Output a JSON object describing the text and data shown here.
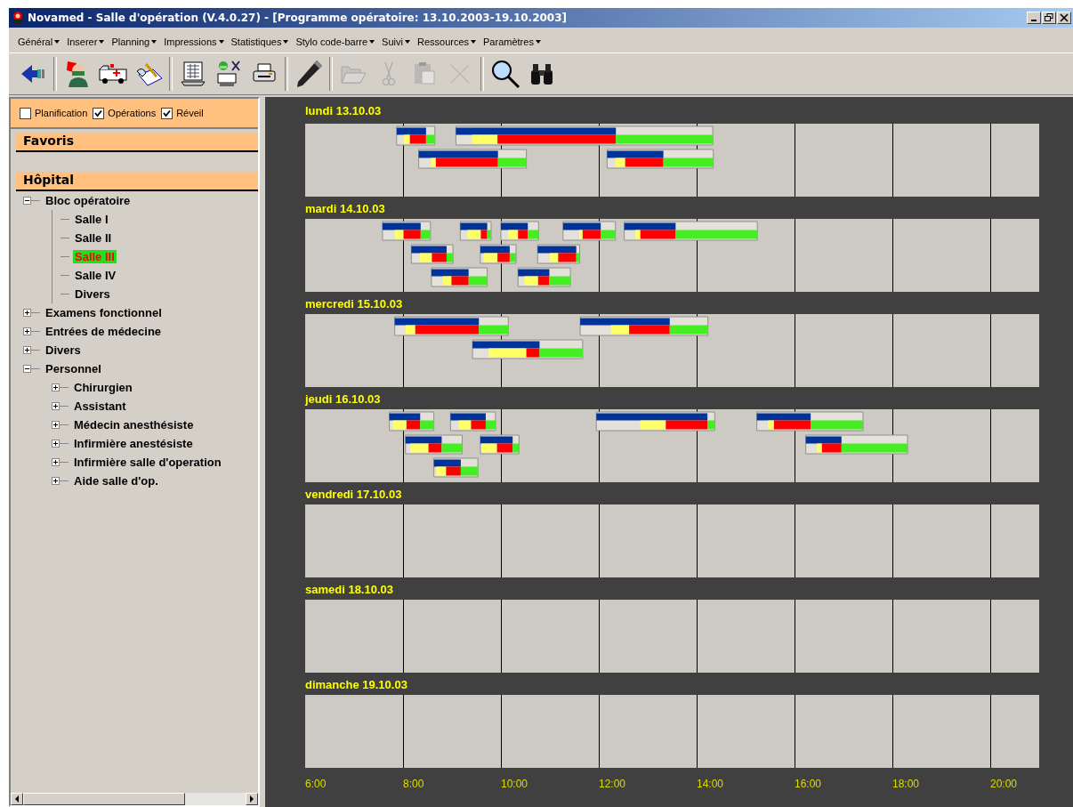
{
  "window": {
    "title": "Novamed - Salle d'opération (V.4.0.27) - [Programme opératoire:  13.10.2003-19.10.2003]"
  },
  "menu": [
    "Général",
    "Inserer",
    "Planning",
    "Impressions",
    "Statistiques",
    "Stylo code-barre",
    "Suivi",
    "Ressources",
    "Paramètres"
  ],
  "toolbar": [
    {
      "kind": "back",
      "disabled": false
    },
    {
      "kind": "sep"
    },
    {
      "kind": "doctor",
      "disabled": false
    },
    {
      "kind": "ambulance",
      "disabled": false
    },
    {
      "kind": "notepad",
      "disabled": false
    },
    {
      "kind": "sep"
    },
    {
      "kind": "calendar",
      "disabled": false
    },
    {
      "kind": "surgeon",
      "disabled": false
    },
    {
      "kind": "printer",
      "disabled": false
    },
    {
      "kind": "sep"
    },
    {
      "kind": "pen",
      "disabled": false
    },
    {
      "kind": "sep"
    },
    {
      "kind": "folder",
      "disabled": true
    },
    {
      "kind": "scissors",
      "disabled": true
    },
    {
      "kind": "clipboard",
      "disabled": true
    },
    {
      "kind": "delete",
      "disabled": true
    },
    {
      "kind": "sep"
    },
    {
      "kind": "magnifier",
      "disabled": false
    },
    {
      "kind": "binoculars",
      "disabled": false
    }
  ],
  "filters": [
    {
      "label": "Planification",
      "checked": false
    },
    {
      "label": "Opérations",
      "checked": true
    },
    {
      "label": "Réveil",
      "checked": true
    }
  ],
  "favorites": {
    "title": "Favoris"
  },
  "hospital": {
    "title": "Hôpital",
    "tree": [
      {
        "label": "Bloc opératoire",
        "expanded": true,
        "selected": false,
        "children": [
          {
            "label": "Salle I",
            "selected": false
          },
          {
            "label": "Salle II",
            "selected": false
          },
          {
            "label": "Salle III",
            "selected": true
          },
          {
            "label": "Salle IV",
            "selected": false
          },
          {
            "label": "Divers",
            "selected": false
          }
        ]
      },
      {
        "label": "Examens fonctionnel",
        "expanded": false,
        "selected": false
      },
      {
        "label": "Entrées de médecine",
        "expanded": false,
        "selected": false
      },
      {
        "label": "Divers",
        "expanded": false,
        "selected": false
      },
      {
        "label": "Personnel",
        "expanded": true,
        "selected": false,
        "children": [
          {
            "label": "Chirurgien",
            "expanded": false,
            "selected": false
          },
          {
            "label": "Assistant",
            "expanded": false,
            "selected": false
          },
          {
            "label": "Médecin anesthésiste",
            "expanded": false,
            "selected": false
          },
          {
            "label": "Infirmière anestésiste",
            "expanded": false,
            "selected": false
          },
          {
            "label": "Infirmière salle d'operation",
            "expanded": false,
            "selected": false
          },
          {
            "label": "Aide salle d'op.",
            "expanded": false,
            "selected": false
          }
        ]
      }
    ]
  },
  "schedule": {
    "days": [
      {
        "label": "lundi 13.10.03"
      },
      {
        "label": "mardi 14.10.03"
      },
      {
        "label": "mercredi 15.10.03"
      },
      {
        "label": "jeudi 16.10.03"
      },
      {
        "label": "vendredi 17.10.03"
      },
      {
        "label": "samedi 18.10.03"
      },
      {
        "label": "dimanche 19.10.03"
      }
    ],
    "hours": [
      "6:00",
      "8:00",
      "10:00",
      "12:00",
      "14:00",
      "16:00",
      "18:00",
      "20:00"
    ]
  }
}
